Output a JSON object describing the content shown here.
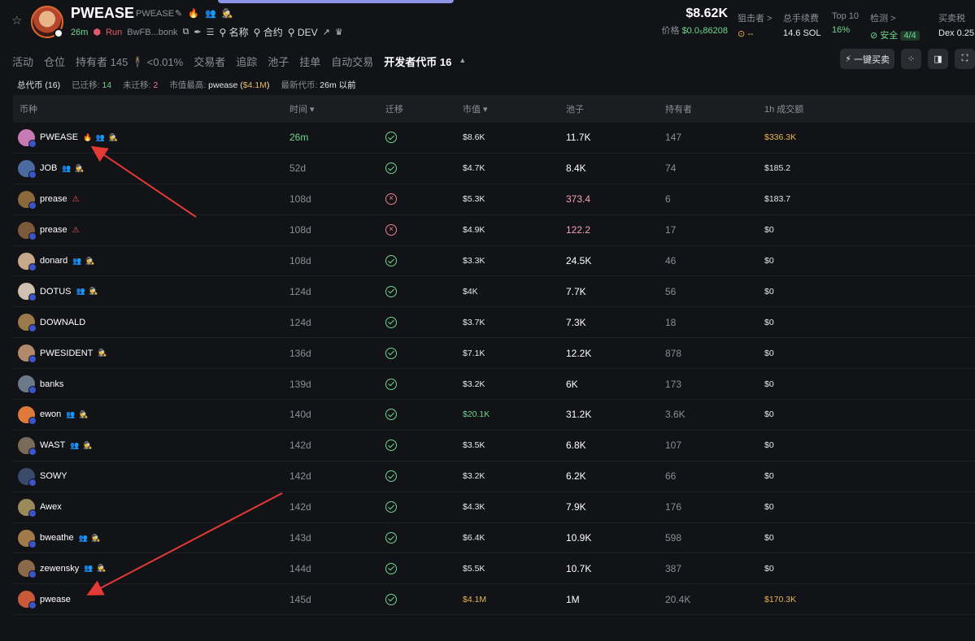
{
  "header": {
    "token_name": "PWEASE",
    "token_symbol": "PWEASE",
    "title_icons": "✎ 🔥 👥 🕵",
    "age": "26m",
    "run_label": "Run",
    "address": "BwFB...bonk",
    "search_name": "名称",
    "search_contract": "合约",
    "search_dev": "DEV",
    "price_usd": "$8.62K",
    "price_label": "价格",
    "price_value": "$0.0₅86208",
    "stats": [
      {
        "label": "狙击者 >",
        "value": "⊙ --"
      },
      {
        "label": "总手续费",
        "value": "14.6 SOL"
      },
      {
        "label": "Top 10",
        "value": "16%"
      },
      {
        "label": "检测 >",
        "value_prefix": "⊘ 安全",
        "value_badge": "4/4"
      },
      {
        "label": "买卖税",
        "value": "Dex 0.25"
      }
    ]
  },
  "tabs": [
    "活动",
    "仓位",
    "持有者 145 🕴 <0.01%",
    "交易者",
    "追踪",
    "池子",
    "挂单",
    "自动交易",
    "开发者代币 16"
  ],
  "tools": {
    "quick_trade": "一键买卖"
  },
  "summary": {
    "total_label": "总代币 (16)",
    "migrated_label": "已迁移:",
    "migrated_value": "14",
    "unmigrated_label": "未迁移:",
    "unmigrated_value": "2",
    "top_mcap_label": "市值最高:",
    "top_mcap_name": "pwease (",
    "top_mcap_value": "$4.1M",
    "top_mcap_close": ")",
    "latest_label": "最新代币:",
    "latest_value": "26m 以前"
  },
  "table": {
    "headers": [
      "币种",
      "时间 ▾",
      "迁移",
      "市值 ▾",
      "池子",
      "持有者",
      "1h 成交额"
    ],
    "rows": [
      {
        "name": "PWEASE",
        "flags": "🔥 👥 🕵",
        "time": "26m",
        "migrated": true,
        "mcap": "$8.6K",
        "pool": "11.7K",
        "holders": "147",
        "vol": "$336.3K",
        "avatar": "#c77bb5"
      },
      {
        "name": "JOB",
        "flags": "👥 🕵",
        "time": "52d",
        "migrated": true,
        "mcap": "$4.7K",
        "pool": "8.4K",
        "holders": "74",
        "vol": "$185.2",
        "avatar": "#4a6aa0"
      },
      {
        "name": "prease",
        "flags": "⚠",
        "time": "108d",
        "migrated": false,
        "mcap": "$5.3K",
        "pool": "373.4",
        "holders": "6",
        "vol": "$183.7",
        "avatar": "#8a6a3a"
      },
      {
        "name": "prease",
        "flags": "⚠",
        "time": "108d",
        "migrated": false,
        "mcap": "$4.9K",
        "pool": "122.2",
        "holders": "17",
        "vol": "$0",
        "avatar": "#7a5a3a"
      },
      {
        "name": "donard",
        "flags": "👥 🕵",
        "time": "108d",
        "migrated": true,
        "mcap": "$3.3K",
        "pool": "24.5K",
        "holders": "46",
        "vol": "$0",
        "avatar": "#c8a88a"
      },
      {
        "name": "DOTUS",
        "flags": "👥 🕵",
        "time": "124d",
        "migrated": true,
        "mcap": "$4K",
        "pool": "7.7K",
        "holders": "56",
        "vol": "$0",
        "avatar": "#d0c0b0"
      },
      {
        "name": "DOWNALD",
        "flags": "",
        "time": "124d",
        "migrated": true,
        "mcap": "$3.7K",
        "pool": "7.3K",
        "holders": "18",
        "vol": "$0",
        "avatar": "#9a7a4a"
      },
      {
        "name": "PWESIDENT",
        "flags": "🕵",
        "time": "136d",
        "migrated": true,
        "mcap": "$7.1K",
        "pool": "12.2K",
        "holders": "878",
        "vol": "$0",
        "avatar": "#b08a6a"
      },
      {
        "name": "banks",
        "flags": "",
        "time": "139d",
        "migrated": true,
        "mcap": "$3.2K",
        "pool": "6K",
        "holders": "173",
        "vol": "$0",
        "avatar": "#6a7a8a"
      },
      {
        "name": "ewon",
        "flags": "👥 🕵",
        "time": "140d",
        "migrated": true,
        "mcap": "$20.1K",
        "pool": "31.2K",
        "holders": "3.6K",
        "vol": "$0",
        "avatar": "#e07a3a"
      },
      {
        "name": "WAST",
        "flags": "👥 🕵",
        "time": "142d",
        "migrated": true,
        "mcap": "$3.5K",
        "pool": "6.8K",
        "holders": "107",
        "vol": "$0",
        "avatar": "#7a6a5a"
      },
      {
        "name": "SOWY",
        "flags": "",
        "time": "142d",
        "migrated": true,
        "mcap": "$3.2K",
        "pool": "6.2K",
        "holders": "66",
        "vol": "$0",
        "avatar": "#3a4a6a"
      },
      {
        "name": "Awex",
        "flags": "",
        "time": "142d",
        "migrated": true,
        "mcap": "$4.3K",
        "pool": "7.9K",
        "holders": "176",
        "vol": "$0",
        "avatar": "#9a8a5a"
      },
      {
        "name": "bweathe",
        "flags": "👥 🕵",
        "time": "143d",
        "migrated": true,
        "mcap": "$6.4K",
        "pool": "10.9K",
        "holders": "598",
        "vol": "$0",
        "avatar": "#a07a4a"
      },
      {
        "name": "zewensky",
        "flags": "👥 🕵",
        "time": "144d",
        "migrated": true,
        "mcap": "$5.5K",
        "pool": "10.7K",
        "holders": "387",
        "vol": "$0",
        "avatar": "#8a6a4a"
      },
      {
        "name": "pwease",
        "flags": "",
        "time": "145d",
        "migrated": true,
        "mcap": "$4.1M",
        "pool": "1M",
        "holders": "20.4K",
        "vol": "$170.3K",
        "avatar": "#c85a3a"
      }
    ]
  },
  "colors": {
    "background": "#121316",
    "accent_green": "#6fd68f",
    "accent_red": "#f07f8d",
    "accent_gold": "#e7b556",
    "arrow_red": "#e53935"
  }
}
